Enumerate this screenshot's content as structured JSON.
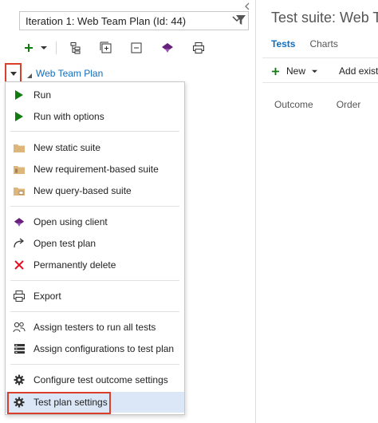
{
  "iteration_select": {
    "value": "Iteration 1: Web Team Plan (Id: 44)"
  },
  "tree": {
    "root_label": "Web Team Plan"
  },
  "menu": {
    "items": [
      {
        "label": "Run",
        "icon": "run-icon"
      },
      {
        "label": "Run with options",
        "icon": "run-options-icon"
      },
      {
        "label": "New static suite",
        "icon": "static-suite-folder-icon"
      },
      {
        "label": "New requirement-based suite",
        "icon": "requirement-suite-icon"
      },
      {
        "label": "New query-based suite",
        "icon": "query-suite-icon"
      },
      {
        "label": "Open using client",
        "icon": "client-icon"
      },
      {
        "label": "Open test plan",
        "icon": "open-arrow-icon"
      },
      {
        "label": "Permanently delete",
        "icon": "delete-x-icon"
      },
      {
        "label": "Export",
        "icon": "printer-icon"
      },
      {
        "label": "Assign testers to run all tests",
        "icon": "testers-icon"
      },
      {
        "label": "Assign configurations to test plan",
        "icon": "configurations-icon"
      },
      {
        "label": "Configure test outcome settings",
        "icon": "gear-icon"
      },
      {
        "label": "Test plan settings",
        "icon": "gear-icon"
      }
    ]
  },
  "right_pane": {
    "title": "Test suite: Web Team Plan",
    "tabs": [
      "Tests",
      "Charts"
    ],
    "new_label": "New",
    "add_label": "Add existing",
    "columns": [
      "Outcome",
      "Order"
    ]
  },
  "colors": {
    "accent": "#106ebe",
    "highlight_frame": "#d9402b",
    "run_green": "#107c10",
    "delete_red": "#e81123",
    "client_purple": "#68217a",
    "folder_tan": "#dcb67a"
  }
}
